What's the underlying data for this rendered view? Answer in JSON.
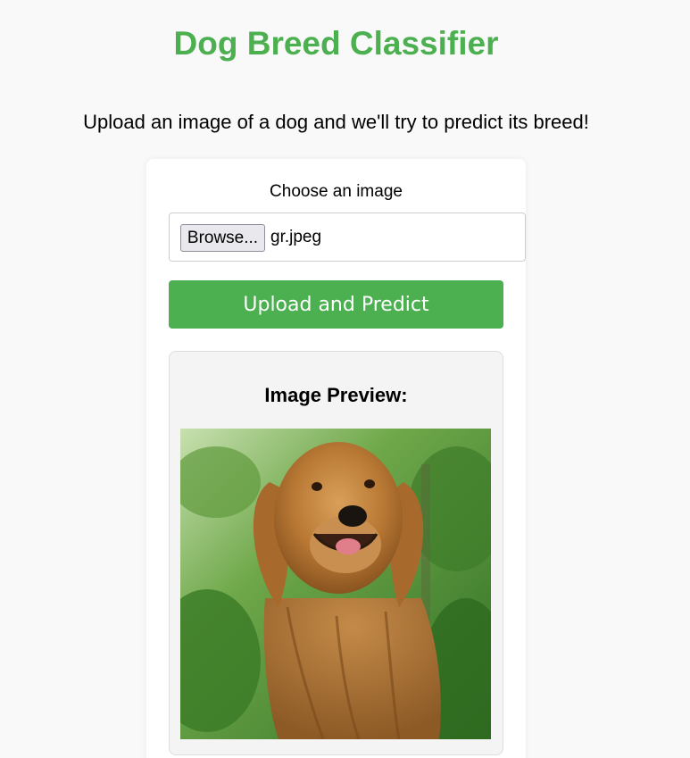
{
  "header": {
    "title": "Dog Breed Classifier",
    "subtitle": "Upload an image of a dog and we'll try to predict its breed!"
  },
  "form": {
    "choose_label": "Choose an image",
    "browse_label": "Browse...",
    "file_name": "gr.jpeg",
    "submit_label": "Upload and Predict"
  },
  "preview": {
    "title": "Image Preview:",
    "image_icon": "golden-retriever-photo"
  },
  "colors": {
    "accent": "#4caf50",
    "background": "#f9f9f9",
    "card": "#ffffff",
    "preview_bg": "#f4f4f4"
  }
}
